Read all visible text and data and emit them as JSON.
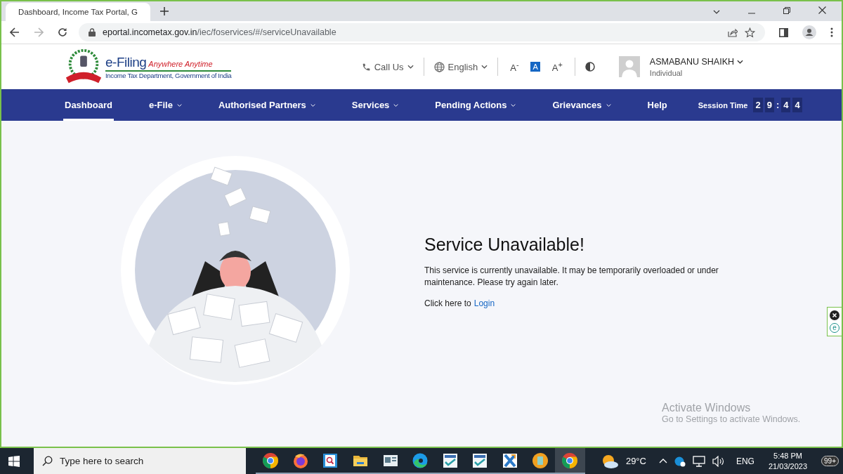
{
  "browser": {
    "tab_title": "Dashboard, Income Tax Portal, G",
    "url": {
      "host": "eportal.incometax.gov.in",
      "path": "/iec/foservices/#/serviceUnavailable"
    },
    "forward_disabled": true
  },
  "header": {
    "brand": "e-Filing",
    "tagline": "Anywhere Anytime",
    "subtitle": "Income Tax Department, Government of India",
    "call_us": "Call Us",
    "language": "English",
    "font_controls": [
      {
        "label": "A$^{-}$",
        "selected": false
      },
      {
        "label": "A",
        "selected": true
      },
      {
        "label": "A$^{+}$",
        "selected": false
      }
    ],
    "user_name": "ASMABANU SHAIKH",
    "user_role": "Individual"
  },
  "nav": {
    "items": [
      {
        "label": "Dashboard",
        "selected": true,
        "has_menu": false
      },
      {
        "label": "e-File",
        "selected": false,
        "has_menu": true
      },
      {
        "label": "Authorised Partners",
        "selected": false,
        "has_menu": true
      },
      {
        "label": "Services",
        "selected": false,
        "has_menu": true
      },
      {
        "label": "Pending Actions",
        "selected": false,
        "has_menu": true
      },
      {
        "label": "Grievances",
        "selected": false,
        "has_menu": true
      },
      {
        "label": "Help",
        "selected": false,
        "has_menu": false
      }
    ],
    "session_label": "Session Time",
    "session_digits": [
      {
        "kind": "digit",
        "text": "2"
      },
      {
        "kind": "digit",
        "text": "9"
      },
      {
        "kind": "separator",
        "text": ":"
      },
      {
        "kind": "digit",
        "text": "4"
      },
      {
        "kind": "digit",
        "text": "4"
      }
    ]
  },
  "message": {
    "title": "Service Unavailable!",
    "body": "This service is currently unavailable. It may be temporarily overloaded or under maintenance. Please try again later.",
    "login_prompt": "Click here to",
    "login_link": "Login"
  },
  "side_widget": {
    "letter": "e"
  },
  "activation": {
    "title": "Activate Windows",
    "hint": "Go to Settings to activate Windows."
  },
  "taskbar": {
    "search_placeholder": "Type here to search",
    "apps": [
      {
        "kind": "chrome",
        "selected": false
      },
      {
        "kind": "firefox",
        "selected": false
      },
      {
        "kind": "media",
        "selected": false
      },
      {
        "kind": "folder",
        "selected": false
      },
      {
        "kind": "reader",
        "selected": false
      },
      {
        "kind": "edge",
        "selected": false
      },
      {
        "kind": "check",
        "selected": false
      },
      {
        "kind": "check",
        "selected": false
      },
      {
        "kind": "cross",
        "selected": false
      },
      {
        "kind": "orb",
        "selected": false
      },
      {
        "kind": "chrome",
        "selected": true
      }
    ],
    "temperature": "29°C",
    "language": "ENG",
    "time": "5:48 PM",
    "date": "21/03/2023",
    "notifications": "99+"
  }
}
